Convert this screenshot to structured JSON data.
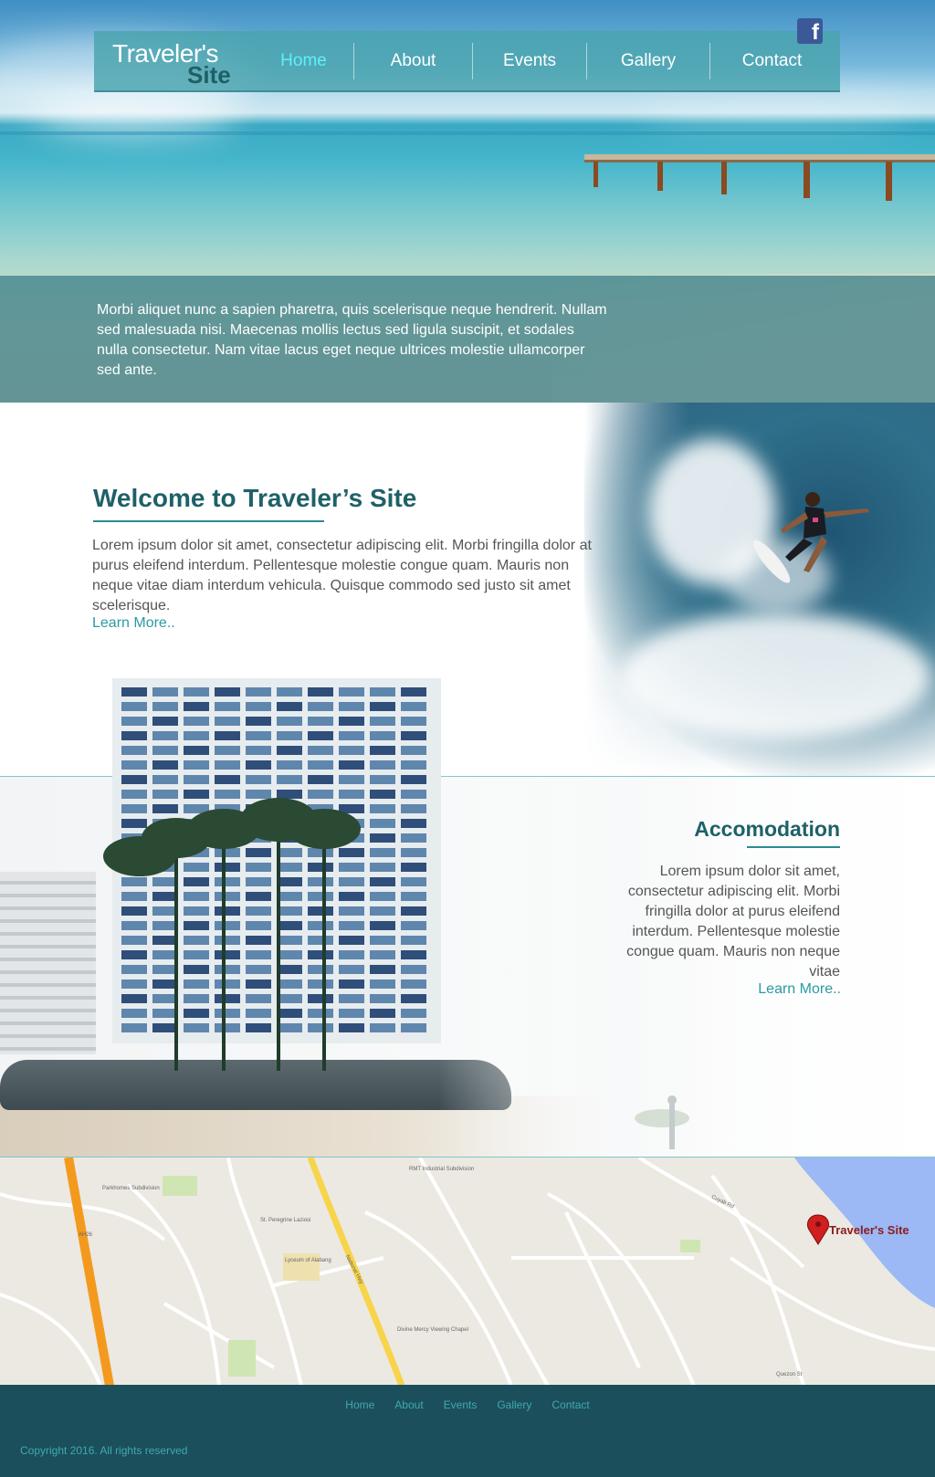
{
  "site": {
    "logo_line1": "Traveler's",
    "logo_line2": "Site",
    "facebook_icon_glyph": "f"
  },
  "nav": {
    "items": [
      {
        "label": "Home",
        "active": true
      },
      {
        "label": "About",
        "active": false
      },
      {
        "label": "Events",
        "active": false
      },
      {
        "label": "Gallery",
        "active": false
      },
      {
        "label": "Contact",
        "active": false
      }
    ]
  },
  "hero": {
    "text": "Morbi aliquet nunc a sapien pharetra, quis scelerisque neque hendrerit. Nullam sed malesuada nisi. Maecenas mollis lectus sed ligula suscipit, et sodales nulla consectetur. Nam vitae lacus eget neque ultrices molestie ullamcorper sed ante."
  },
  "welcome": {
    "title": "Welcome to Traveler’s Site",
    "text": "Lorem ipsum dolor sit amet, consectetur adipiscing elit. Morbi fringilla dolor at purus eleifend interdum. Pellentesque molestie congue quam. Mauris non neque vitae diam interdum vehicula. Quisque commodo sed justo sit amet scelerisque.",
    "link": "Learn More.."
  },
  "accomodation": {
    "title": "Accomodation",
    "text": "Lorem ipsum dolor sit amet, consectetur adipiscing elit. Morbi fringilla dolor at purus eleifend interdum. Pellentesque molestie congue quam. Mauris non neque vitae",
    "link": "Learn More.."
  },
  "map": {
    "pin_label": "Traveler's Site",
    "labels": [
      "Parkhomes Subdivision",
      "RMT Industrial Subdivision",
      "St. Peregrine Laziosi",
      "Lyceum of Alabang",
      "Divine Mercy Viewing Chapel",
      "National Hwy",
      "Cuyab Rd",
      "Quezon St",
      "AH26"
    ]
  },
  "footer": {
    "nav": [
      "Home",
      "About",
      "Events",
      "Gallery",
      "Contact"
    ],
    "copyright": "Copyright 2016. All rights reserved"
  },
  "colors": {
    "accent": "#2b9aa4",
    "heading": "#1e6168",
    "footer_bg": "#1b4f5c",
    "nav_active": "#5ff0f6",
    "facebook": "#3b5998",
    "pin": "#d11f1f"
  }
}
